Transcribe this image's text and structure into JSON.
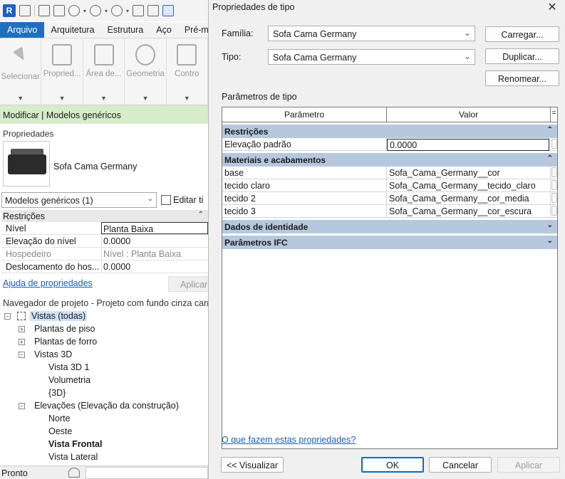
{
  "revit": {
    "tabs": [
      "Arquivo",
      "Arquitetura",
      "Estrutura",
      "Aço",
      "Pré-m"
    ],
    "ribbon": [
      "Selecionar",
      "Propried...",
      "Área de...",
      "Geometria",
      "Contro"
    ],
    "context_bar": "Modificar | Modelos genéricos",
    "properties_title": "Propriedades",
    "family_name": "Sofa Cama Germany",
    "category_select": "Modelos genéricos (1)",
    "edit_type": "Editar ti",
    "section": "Restrições",
    "rows": [
      {
        "key": "Nível",
        "value": "Planta Baixa"
      },
      {
        "key": "Elevação do nível",
        "value": "0.0000"
      },
      {
        "key": "Hospedeiro",
        "value": "Nível : Planta Baixa"
      },
      {
        "key": "Deslocamento do hos...",
        "value": "0.0000"
      }
    ],
    "help_link": "Ajuda de propriedades",
    "apply": "Aplicar",
    "navigator_title": "Navegador de projeto - Projeto com fundo cinza carro",
    "tree": {
      "root": "Vistas (todas)",
      "plantas_piso": "Plantas de piso",
      "plantas_forro": "Plantas de forro",
      "vistas3d": "Vistas 3D",
      "vista3d1": "Vista 3D 1",
      "volumetria": "Volumetria",
      "view3d": "{3D}",
      "elevacoes": "Elevações (Elevação da construção)",
      "norte": "Norte",
      "oeste": "Oeste",
      "frontal": "Vista Frontal",
      "lateral": "Vista Lateral"
    },
    "status": "Pronto"
  },
  "dialog": {
    "title": "Propriedades de tipo",
    "family_label": "Família:",
    "family_value": "Sofa Cama Germany",
    "type_label": "Tipo:",
    "type_value": "Sofa Cama Germany",
    "load_button": "Carregar...",
    "duplicate_button": "Duplicar...",
    "rename_button": "Renomear...",
    "type_params_label": "Parâmetros de tipo",
    "col_param": "Parâmetro",
    "col_value": "Valor",
    "col_extra": "=",
    "sections": {
      "restricoes": "Restrições",
      "materiais": "Materiais e acabamentos",
      "identidade": "Dados de identidade",
      "ifc": "Parâmetros IFC"
    },
    "restricoes_rows": [
      {
        "key": "Elevação padrão",
        "value": "0.0000"
      }
    ],
    "materiais_rows": [
      {
        "key": "base",
        "value": "Sofa_Cama_Germany__cor"
      },
      {
        "key": "tecido claro",
        "value": "Sofa_Cama_Germany__tecido_claro"
      },
      {
        "key": "tecido 2",
        "value": "Sofa_Cama_Germany__cor_media"
      },
      {
        "key": "tecido 3",
        "value": "Sofa_Cama_Germany__cor_escura"
      }
    ],
    "help_link": "O que fazem estas propriedades?",
    "preview_button": "<< Visualizar",
    "ok_button": "OK",
    "cancel_button": "Cancelar",
    "apply_button": "Aplicar"
  },
  "colors": {
    "accent": "#1f6fbf",
    "context_bar": "#d7ecc8",
    "section_header": "#b6c8de",
    "link": "#1a5fb4"
  }
}
